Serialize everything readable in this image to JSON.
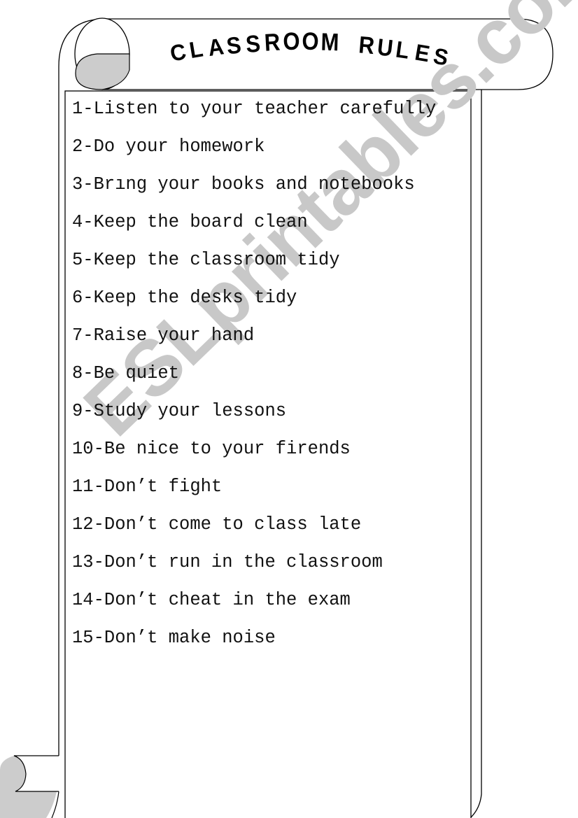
{
  "worksheet": {
    "title": "CLASSROOM RULES",
    "rules": [
      "1-Listen to your teacher carefully",
      "2-Do your homework",
      "3-Brıng your books and notebooks",
      "4-Keep the board clean",
      "5-Keep the classroom tidy",
      "6-Keep the desks tidy",
      "7-Raise your hand",
      "8-Be quiet",
      "9-Study your lessons",
      "10-Be nice to your firends",
      "11-Don’t fight",
      "12-Don’t come to class late",
      "13-Don’t run in the classroom",
      "14-Don’t cheat in the exam",
      "15-Don’t make noise"
    ]
  },
  "watermark": {
    "text": "ESLprintables.com",
    "color": "#c8c8c8"
  },
  "colors": {
    "scroll_curl_fill": "#cccccc",
    "line": "#000000",
    "text": "#111111"
  }
}
